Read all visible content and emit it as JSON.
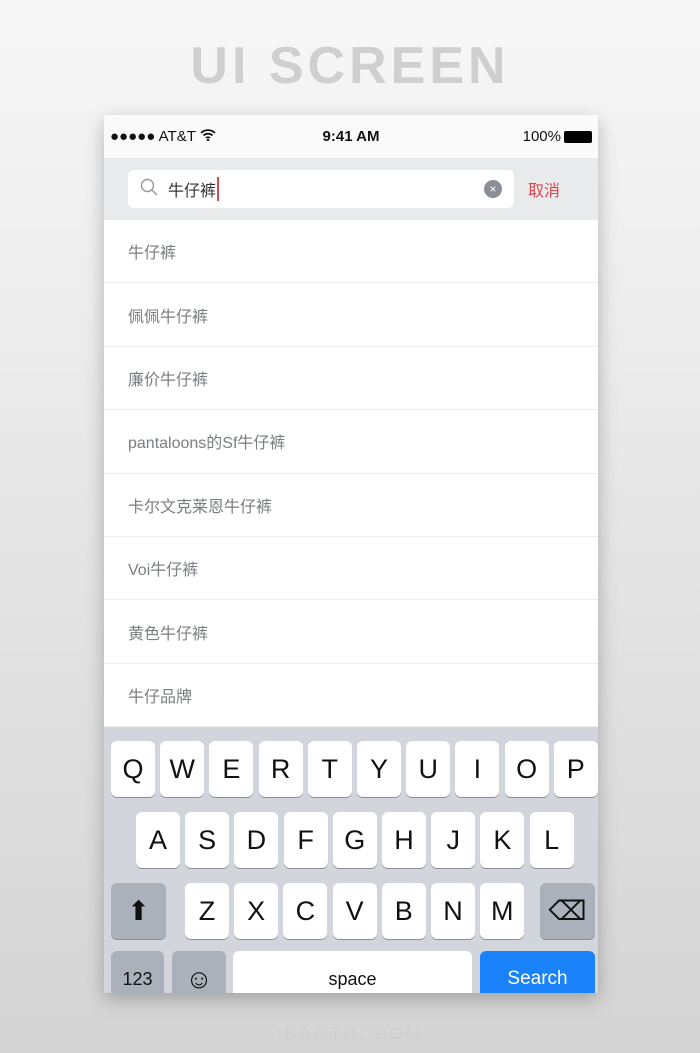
{
  "banner": {
    "title": "UI SCREEN",
    "footer": "IBAOTU. COM"
  },
  "status": {
    "carrier": "●●●●● AT&T",
    "wifi": "wifi-icon",
    "time": "9:41 AM",
    "battery": "100%"
  },
  "search": {
    "query": "牛仔裤",
    "cancel": "取消",
    "clear": "×"
  },
  "suggestions": [
    "牛仔裤",
    "佩佩牛仔裤",
    "廉价牛仔裤",
    "pantaloons的Sf牛仔裤",
    "卡尔文克莱恩牛仔裤",
    "Voi牛仔裤",
    "黄色牛仔裤",
    "牛仔品牌"
  ],
  "keyboard": {
    "row1": [
      "Q",
      "W",
      "E",
      "R",
      "T",
      "Y",
      "U",
      "I",
      "O",
      "P"
    ],
    "row2": [
      "A",
      "S",
      "D",
      "F",
      "G",
      "H",
      "J",
      "K",
      "L"
    ],
    "row3": [
      "Z",
      "X",
      "C",
      "V",
      "B",
      "N",
      "M"
    ],
    "shift": "⬆",
    "backspace": "⌫",
    "numbers": "123",
    "emoji": "☺",
    "space": "space",
    "search": "Search"
  },
  "colors": {
    "accent": "#d84a4f",
    "search_key": "#1a82fb",
    "keyboard_bg": "#d2d5db"
  }
}
